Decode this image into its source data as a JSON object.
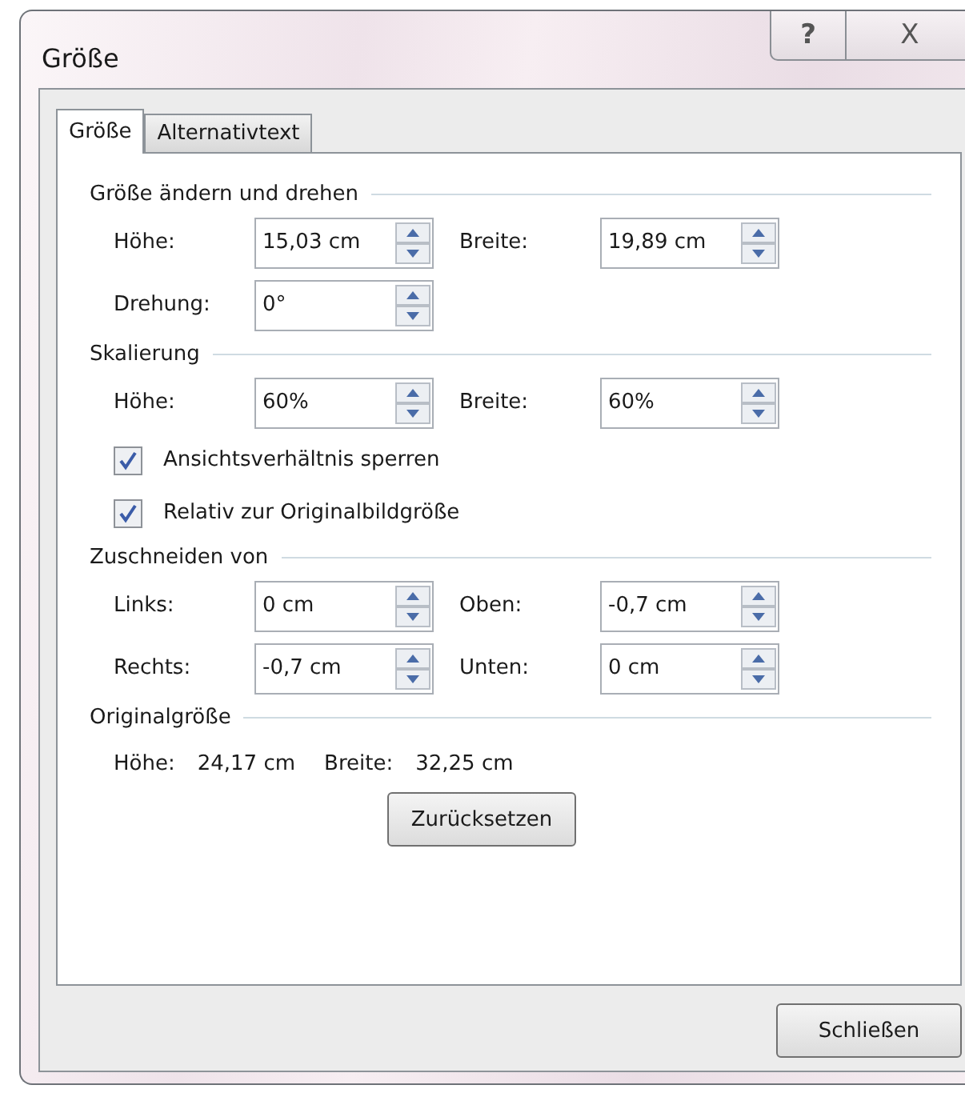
{
  "window": {
    "title": "Größe",
    "buttons": [
      {
        "kind": "help",
        "label": "?"
      },
      {
        "kind": "close",
        "label": "X"
      }
    ]
  },
  "tabs": [
    {
      "label": "Größe",
      "selected": true
    },
    {
      "label": "Alternativtext",
      "selected": false
    }
  ],
  "sections": [
    {
      "title": "Größe ändern und drehen",
      "items": [
        {
          "kind": "fields",
          "fields": [
            {
              "label": "Höhe:",
              "value": "15,03 cm"
            },
            {
              "label": "Breite:",
              "value": "19,89 cm"
            }
          ]
        },
        {
          "kind": "fields",
          "fields": [
            {
              "label": "Drehung:",
              "value": "0°"
            }
          ]
        }
      ]
    },
    {
      "title": "Skalierung",
      "items": [
        {
          "kind": "fields",
          "fields": [
            {
              "label": "Höhe:",
              "value": "60%"
            },
            {
              "label": "Breite:",
              "value": "60%"
            }
          ]
        },
        {
          "kind": "checkbox",
          "label": "Ansichtsverhältnis sperren",
          "checked": true
        },
        {
          "kind": "checkbox",
          "label": "Relativ zur Originalbildgröße",
          "checked": true
        }
      ]
    },
    {
      "title": "Zuschneiden von",
      "items": [
        {
          "kind": "fields",
          "fields": [
            {
              "label": "Links:",
              "value": "0 cm"
            },
            {
              "label": "Oben:",
              "value": "-0,7 cm"
            }
          ]
        },
        {
          "kind": "fields",
          "fields": [
            {
              "label": "Rechts:",
              "value": "-0,7 cm"
            },
            {
              "label": "Unten:",
              "value": "0 cm"
            }
          ]
        }
      ]
    },
    {
      "title": "Originalgröße",
      "items": [
        {
          "kind": "info",
          "pairs": [
            {
              "label": "Höhe:",
              "value": "24,17 cm"
            },
            {
              "label": "Breite:",
              "value": "32,25 cm"
            }
          ]
        },
        {
          "kind": "button",
          "label": "Zurücksetzen"
        }
      ]
    }
  ],
  "footer_button": "Schließen"
}
